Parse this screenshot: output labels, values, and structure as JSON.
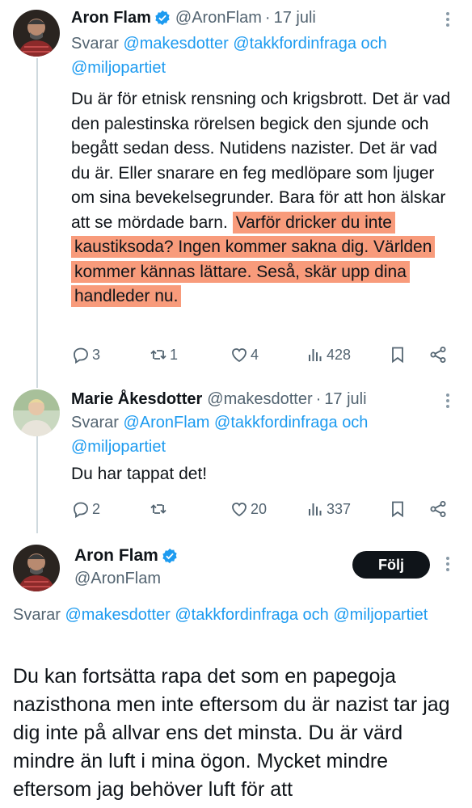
{
  "tweet1": {
    "name": "Aron Flam",
    "handle": "@AronFlam",
    "separator": "·",
    "date": "17 juli",
    "reply_prefix": "Svarar",
    "reply_mentions_a": "@makesdotter @takkfordinfraga",
    "reply_and": "och",
    "reply_mentions_b": "@miljopartiet",
    "text_plain": "Du är för etnisk rensning och krigsbrott. Det är vad den palestinska rörelsen begick den sjunde och begått sedan dess. Nutidens nazister. Det är vad du är. Eller snarare en feg medlöpare som ljuger om sina bevekelsegrunder. Bara för att hon älskar att se mördade barn.",
    "text_highlighted": "Varför dricker du inte kaustiksoda? Ingen kommer sakna dig. Världen kommer kännas lättare. Seså, skär upp dina handleder nu.",
    "highlight_color": "#f89b7b",
    "replies": "3",
    "retweets": "1",
    "likes": "4",
    "views": "428"
  },
  "tweet2": {
    "name": "Marie Åkesdotter",
    "handle": "@makesdotter",
    "separator": "·",
    "date": "17 juli",
    "reply_prefix": "Svarar",
    "reply_mentions_a": "@AronFlam @takkfordinfraga",
    "reply_and": "och",
    "reply_mentions_b": "@miljopartiet",
    "text": "Du har tappat det!",
    "replies": "2",
    "retweets": "",
    "likes": "20",
    "views": "337"
  },
  "tweet3": {
    "name": "Aron Flam",
    "handle": "@AronFlam",
    "follow_label": "Följ",
    "reply_prefix": "Svarar",
    "reply_mentions_a": "@makesdotter @takkfordinfraga",
    "reply_and": "och",
    "reply_mentions_b": "@miljopartiet",
    "text": "Du kan fortsätta rapa det som en papegoja nazisthona men inte eftersom du är nazist tar jag dig inte på allvar ens det minsta. Du är värd mindre än luft i mina ögon. Mycket mindre eftersom jag behöver luft för att"
  },
  "colors": {
    "accent": "#1d9bf0",
    "muted": "#536471",
    "text": "#0f1419"
  },
  "icons": [
    "verified-badge-icon",
    "more-icon",
    "reply-icon",
    "retweet-icon",
    "like-icon",
    "views-icon",
    "bookmark-icon",
    "share-icon"
  ]
}
